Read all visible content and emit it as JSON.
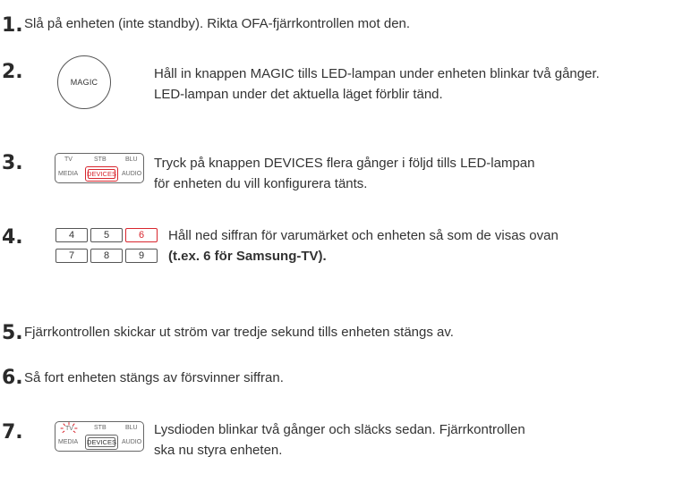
{
  "steps": [
    {
      "number": "1.",
      "lines": [
        "Slå på enheten (inte standby). Rikta OFA-fjärrkontrollen mot den."
      ]
    },
    {
      "number": "2.",
      "lines": [
        "Håll in knappen MAGIC tills LED-lampan under enheten blinkar två gånger.",
        "LED-lampan under det aktuella läget förblir tänd."
      ],
      "button_label": "MAGIC"
    },
    {
      "number": "3.",
      "lines": [
        "Tryck på knappen DEVICES flera gånger i följd tills LED-lampan",
        "för enheten du vill konfigurera tänts."
      ]
    },
    {
      "number": "4.",
      "lines": [
        "Håll ned siffran för varumärket och enheten så som de visas ovan"
      ],
      "bold_line": "(t.ex. 6  för Samsung-TV).",
      "keys": [
        "4",
        "5",
        "6",
        "7",
        "8",
        "9"
      ],
      "highlighted_key": "6"
    },
    {
      "number": "5.",
      "lines": [
        "Fjärrkontrollen skickar ut ström var tredje sekund tills enheten stängs av."
      ]
    },
    {
      "number": "6.",
      "lines": [
        "Så fort enheten stängs av försvinner siffran."
      ]
    },
    {
      "number": "7.",
      "lines": [
        "Lysdioden blinkar två gånger  och släcks sedan. Fjärrkontrollen",
        "ska nu styra enheten."
      ]
    }
  ],
  "device_panel": {
    "tv": "TV",
    "stb": "STB",
    "blu": "BLU",
    "media": "MEDIA",
    "devices": "DEVICES",
    "audio": "AUDIO"
  },
  "colors": {
    "accent": "#d8262e",
    "text": "#333333"
  }
}
